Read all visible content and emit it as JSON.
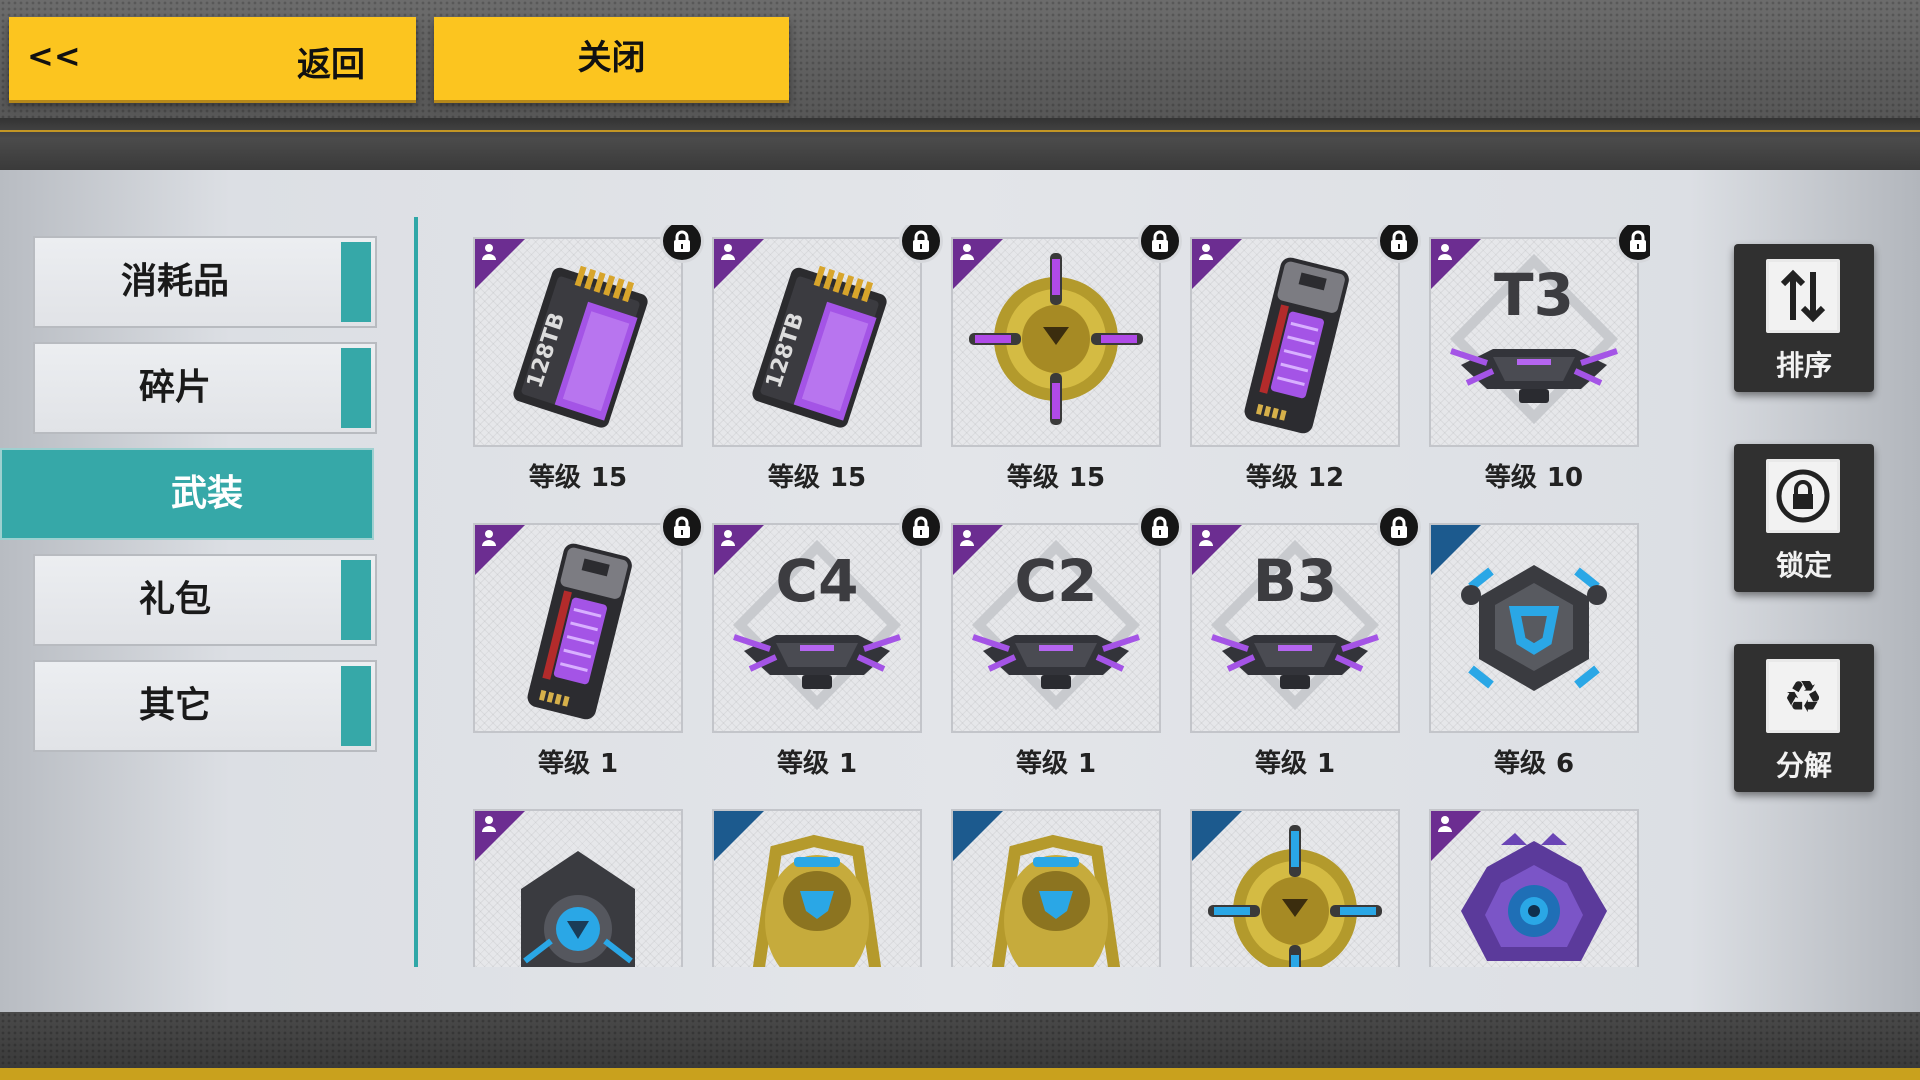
{
  "header": {
    "back_arrows": "<<",
    "back_label": "返回",
    "close_label": "关闭"
  },
  "sidebar": {
    "items": [
      {
        "label": "消耗品",
        "active": false
      },
      {
        "label": "碎片",
        "active": false
      },
      {
        "label": "武装",
        "active": true
      },
      {
        "label": "礼包",
        "active": false
      },
      {
        "label": "其它",
        "active": false
      }
    ]
  },
  "inventory": {
    "level_prefix": "等级",
    "items": [
      {
        "icon": "purple-memory-card-icon",
        "rarity": "purple",
        "locked": true,
        "level": "15",
        "card_text": "128TB"
      },
      {
        "icon": "purple-memory-card-icon",
        "rarity": "purple",
        "locked": true,
        "level": "15",
        "card_text": "128TB"
      },
      {
        "icon": "gold-crosshair-core-icon",
        "rarity": "purple",
        "locked": true,
        "level": "15"
      },
      {
        "icon": "purple-battery-cell-icon",
        "rarity": "purple",
        "locked": true,
        "level": "12"
      },
      {
        "icon": "purple-drone-base-icon",
        "rarity": "purple",
        "locked": true,
        "level": "10",
        "code": "T3"
      },
      {
        "icon": "purple-battery-cell-icon",
        "rarity": "purple",
        "locked": true,
        "level": "1"
      },
      {
        "icon": "purple-drone-base-icon",
        "rarity": "purple",
        "locked": true,
        "level": "1",
        "code": "C4"
      },
      {
        "icon": "purple-drone-base-icon",
        "rarity": "purple",
        "locked": true,
        "level": "1",
        "code": "C2"
      },
      {
        "icon": "purple-drone-base-icon",
        "rarity": "purple",
        "locked": true,
        "level": "1",
        "code": "B3"
      },
      {
        "icon": "blue-hex-module-icon",
        "rarity": "blue",
        "locked": false,
        "level": "6"
      },
      {
        "icon": "blue-shield-core-icon",
        "rarity": "purple",
        "locked": false,
        "level": ""
      },
      {
        "icon": "gold-armor-pod-icon",
        "rarity": "blue",
        "locked": false,
        "level": ""
      },
      {
        "icon": "gold-armor-pod-icon",
        "rarity": "blue",
        "locked": false,
        "level": ""
      },
      {
        "icon": "gold-crosshair-core-blue-icon",
        "rarity": "blue",
        "locked": false,
        "level": ""
      },
      {
        "icon": "violet-eye-core-icon",
        "rarity": "purple",
        "locked": false,
        "level": ""
      }
    ]
  },
  "actions": {
    "sort_label": "排序",
    "lock_label": "锁定",
    "dismantle_label": "分解"
  },
  "colors": {
    "accent_yellow": "#fcc51f",
    "teal": "#36a8a8",
    "rarity_purple": "#6c2d91",
    "rarity_blue": "#1c5a8e"
  }
}
